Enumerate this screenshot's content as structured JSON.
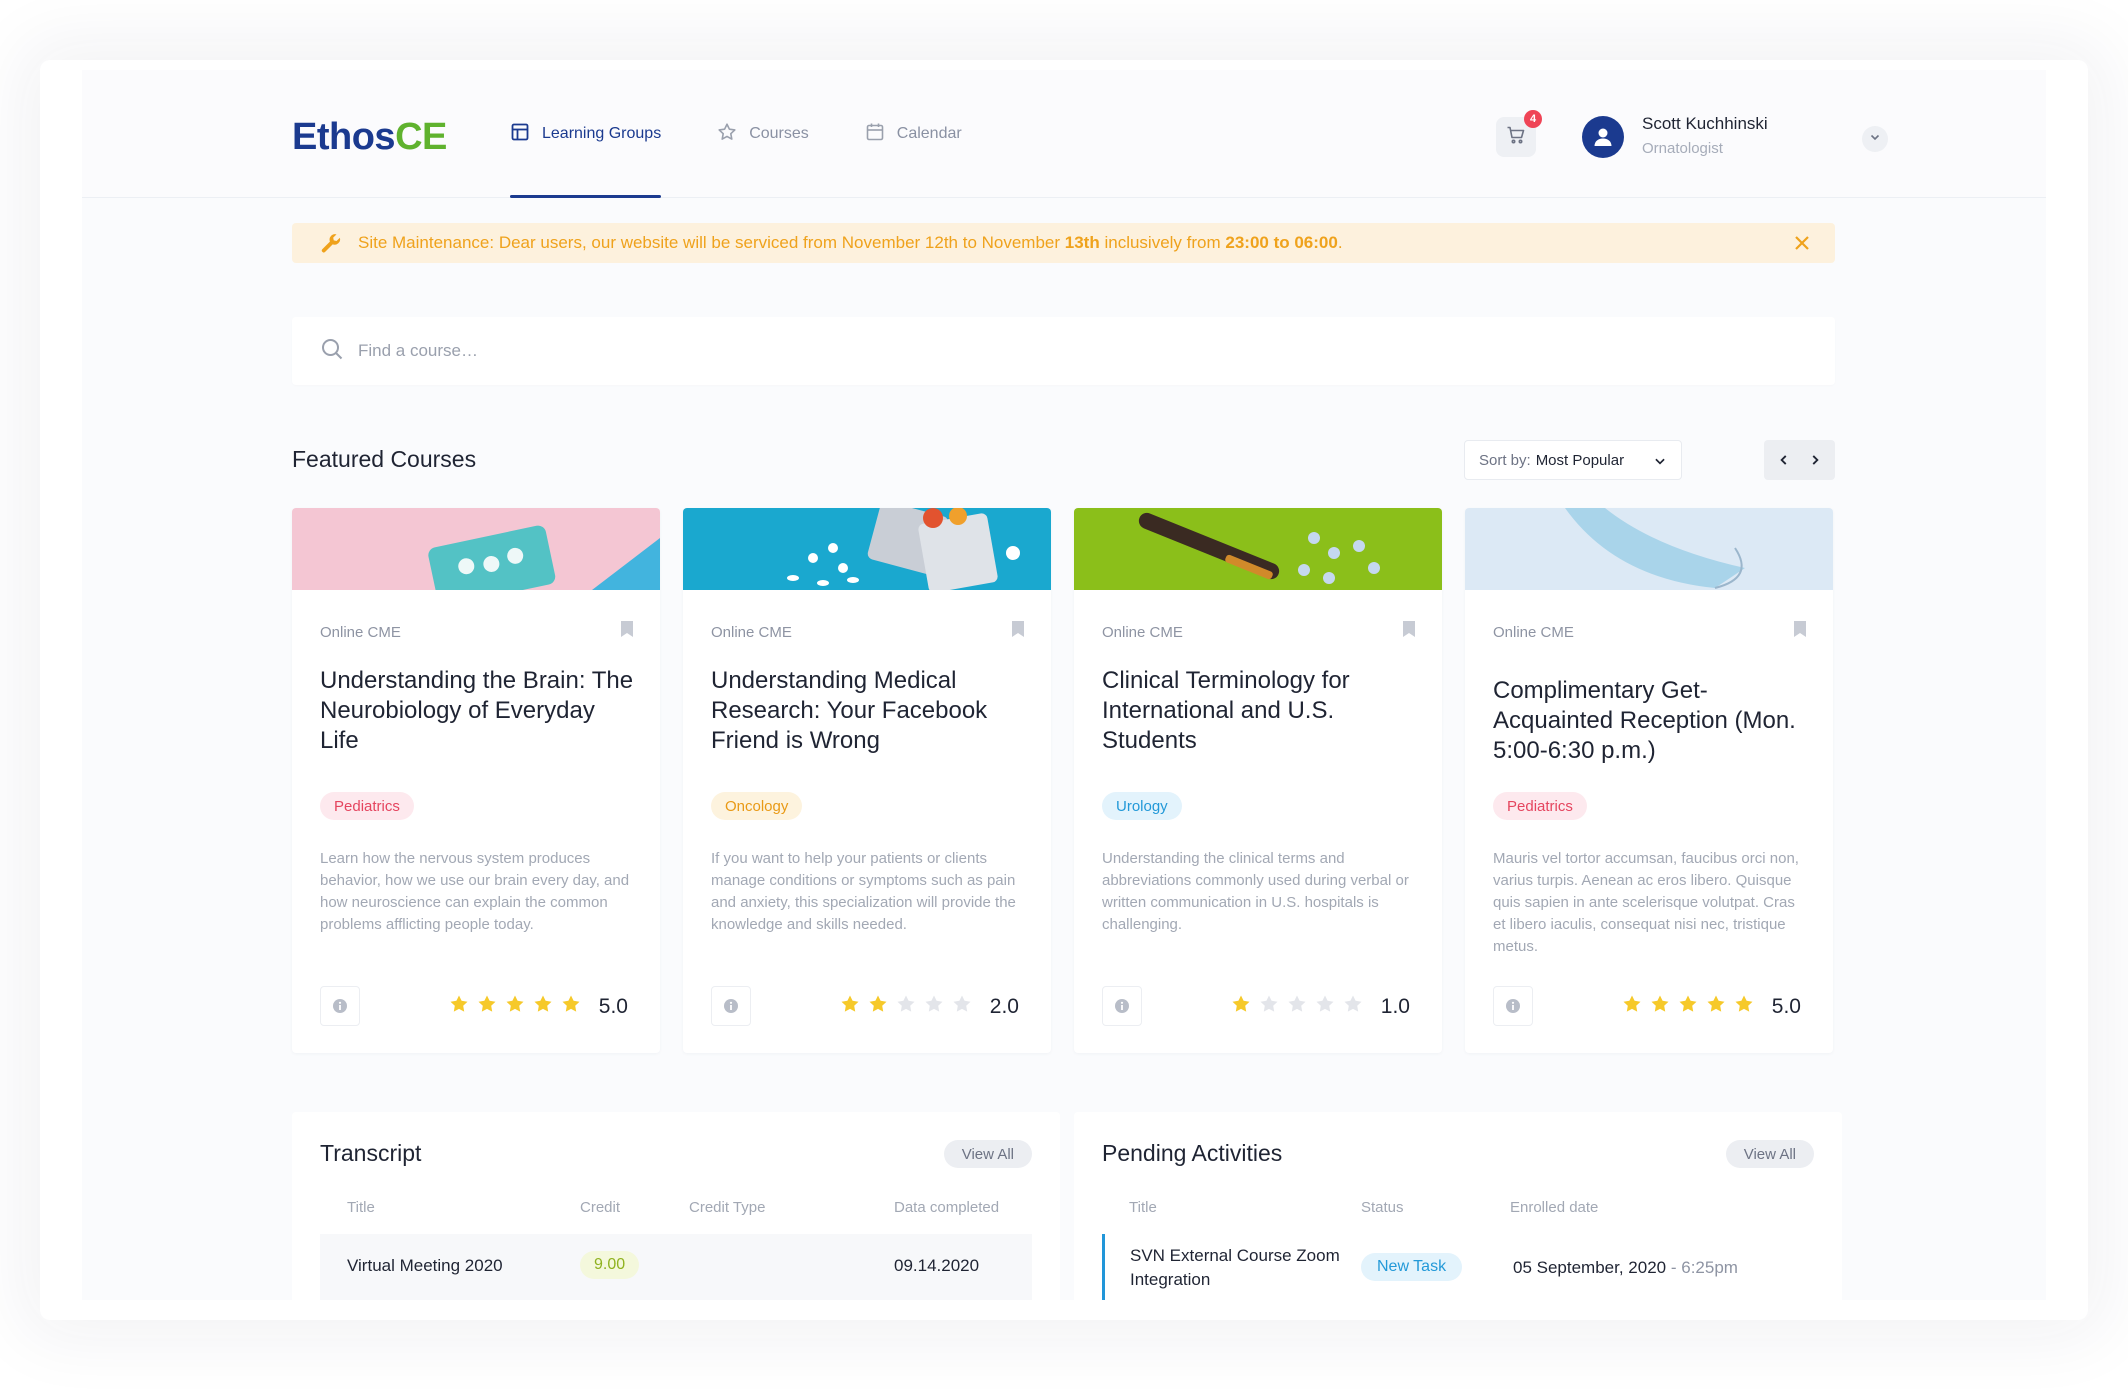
{
  "brand": {
    "part1": "Ethos",
    "part2": "CE"
  },
  "nav": [
    {
      "label": "Learning Groups",
      "icon": "layout-icon",
      "active": true
    },
    {
      "label": "Courses",
      "icon": "star-icon",
      "active": false
    },
    {
      "label": "Calendar",
      "icon": "calendar-icon",
      "active": false
    }
  ],
  "cart": {
    "count": "4"
  },
  "user": {
    "name": "Scott Kuchhinski",
    "role": "Ornatologist"
  },
  "banner": {
    "label": "Site Maintenance:",
    "text1": " Dear users, our website will be serviced from November 12th to November ",
    "date_end": "13th",
    "text2": " inclusively from ",
    "time": "23:00 to 06:00",
    "text3": "."
  },
  "search": {
    "placeholder": "Find a course…"
  },
  "featured": {
    "title": "Featured Courses",
    "sort_label": "Sort by:",
    "sort_value": "Most Popular"
  },
  "courses": [
    {
      "category": "Online CME",
      "title": "Understanding the Brain: The Neurobiology of Everyday Life",
      "tag": "Pediatrics",
      "description": "Learn how the nervous system produces behavior, how we use our brain every day, and how neuroscience can explain the common problems afflicting people today.",
      "rating": "5.0",
      "stars": 5
    },
    {
      "category": "Online CME",
      "title": "Understanding Medical Research: Your Facebook Friend is Wrong",
      "tag": "Oncology",
      "description": "If you want to help your patients or clients manage conditions or symptoms such as pain and anxiety, this specialization will provide the knowledge and skills needed.",
      "rating": "2.0",
      "stars": 2
    },
    {
      "category": "Online CME",
      "title": "Clinical Terminology for International and U.S. Students",
      "tag": "Urology",
      "description": "Understanding the clinical terms and abbreviations commonly used during verbal or written communication in U.S. hospitals is challenging.",
      "rating": "1.0",
      "stars": 1
    },
    {
      "category": "Online CME",
      "title": "Complimentary Get-Acquainted Reception (Mon. 5:00-6:30 p.m.)",
      "tag": "Pediatrics",
      "description": "Mauris vel tortor accumsan, faucibus orci non, varius turpis. Aenean ac eros libero. Quisque quis sapien in ante scelerisque volutpat. Cras et libero iaculis, consequat nisi nec, tristique metus.",
      "rating": "5.0",
      "stars": 5
    }
  ],
  "transcript": {
    "title": "Transcript",
    "view_all": "View All",
    "headers": [
      "Title",
      "Credit",
      "Credit Type",
      "Data completed"
    ],
    "rows": [
      {
        "title": "Virtual Meeting 2020",
        "credit": "9.00",
        "credit_type": "",
        "date": "09.14.2020"
      }
    ]
  },
  "pending": {
    "title": "Pending Activities",
    "view_all": "View All",
    "headers": [
      "Title",
      "Status",
      "Enrolled date"
    ],
    "rows": [
      {
        "title": "SVN External Course Zoom Integration",
        "status": "New Task",
        "date": "05 September, 2020",
        "sep": " - ",
        "time": "6:25pm"
      }
    ]
  },
  "colors": {
    "brand_blue": "#1b3a8f",
    "brand_green": "#5fb22e",
    "star": "#f6c92a",
    "star_empty": "#e3e5ea",
    "warning": "#efa21c"
  }
}
